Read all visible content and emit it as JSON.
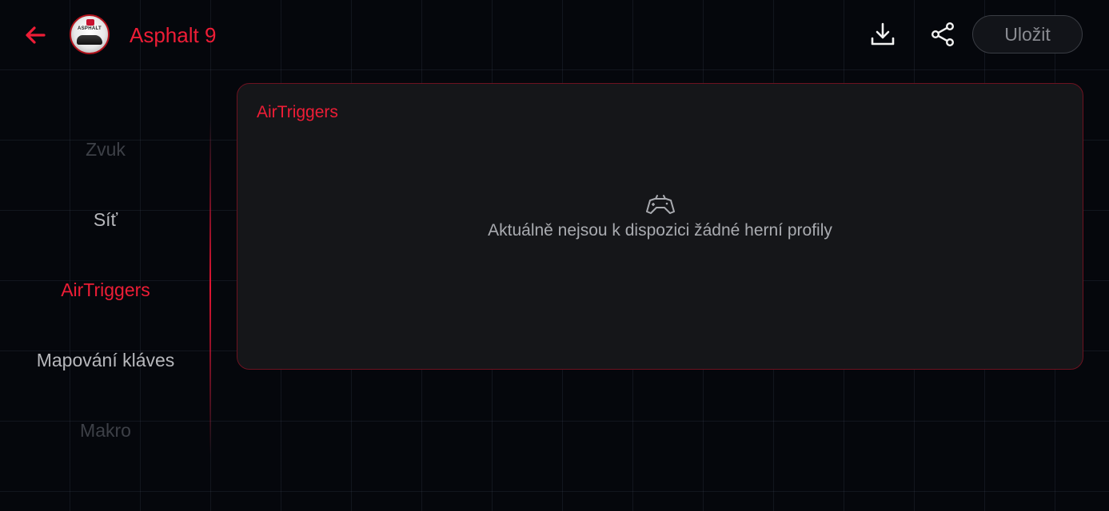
{
  "header": {
    "app_title": "Asphalt 9",
    "avatar_brand": "ASPHALT",
    "save_label": "Uložit",
    "icons": {
      "back": "arrow-left-icon",
      "download": "download-icon",
      "share": "share-icon"
    }
  },
  "sidebar": {
    "items": [
      {
        "label": "Zvuk",
        "state": "faded"
      },
      {
        "label": "Síť",
        "state": "normal"
      },
      {
        "label": "AirTriggers",
        "state": "active"
      },
      {
        "label": "Mapování kláves",
        "state": "normal"
      },
      {
        "label": "Makro",
        "state": "faded"
      }
    ]
  },
  "panel": {
    "title": "AirTriggers",
    "empty_message": "Aktuálně nejsou k dispozici žádné herní profily",
    "empty_icon": "gamepad-icon"
  },
  "colors": {
    "accent": "#ee1d36",
    "background": "#05070c",
    "panel_bg": "#151619",
    "panel_border": "#6d1220"
  }
}
